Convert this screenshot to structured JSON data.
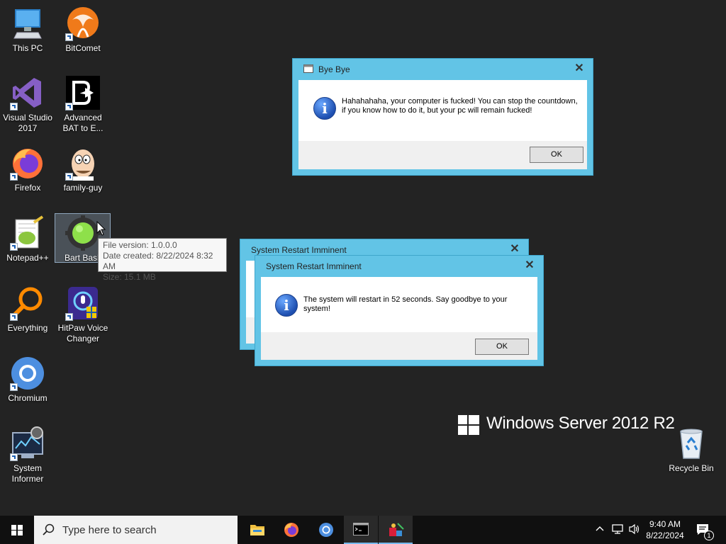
{
  "desktop_icons": [
    {
      "label": "This PC",
      "icon": "this-pc-icon"
    },
    {
      "label": "BitComet",
      "icon": "bitcomet-icon"
    },
    {
      "label": "Visual Studio 2017",
      "icon": "visual-studio-icon"
    },
    {
      "label": "Advanced BAT to E...",
      "icon": "bat-to-exe-icon"
    },
    {
      "label": "Firefox",
      "icon": "firefox-icon"
    },
    {
      "label": "family-guy",
      "icon": "family-guy-icon"
    },
    {
      "label": "Notepad++",
      "icon": "notepad-plus-plus-icon"
    },
    {
      "label": "Bart Bash",
      "icon": "bart-bash-icon"
    },
    {
      "label": "Everything",
      "icon": "everything-icon"
    },
    {
      "label": "HitPaw Voice Changer",
      "icon": "hitpaw-icon"
    },
    {
      "label": "Chromium",
      "icon": "chromium-icon"
    },
    {
      "label": "System Informer",
      "icon": "system-informer-icon"
    },
    {
      "label": "Recycle Bin",
      "icon": "recycle-bin-icon"
    }
  ],
  "tooltip": {
    "file_version": "File version: 1.0.0.0",
    "date_created": "Date created: 8/22/2024 8:32 AM",
    "size": "Size: 15.1 MB"
  },
  "dialogs": {
    "bye_bye": {
      "title": "Bye Bye",
      "message": "Hahahahaha, your computer is fucked! You can stop the countdown, if you know how to do it, but your pc will remain fucked!",
      "ok_label": "OK",
      "close_label": "✕"
    },
    "restart_back": {
      "title": "System Restart Imminent",
      "close_label": "✕"
    },
    "restart_front": {
      "title": "System Restart Imminent",
      "message": "The system will restart in 52 seconds. Say goodbye to your system!",
      "ok_label": "OK",
      "close_label": "✕"
    }
  },
  "branding": {
    "os_name": "Windows Server 2012 R2"
  },
  "taskbar": {
    "search_placeholder": "Type here to search",
    "apps": [
      "file-explorer-icon",
      "firefox-icon",
      "chromium-icon",
      "command-prompt-icon",
      "app-icon"
    ],
    "time": "9:40 AM",
    "date": "8/22/2024",
    "notification_count": "1"
  },
  "colors": {
    "desktop_bg": "#232323",
    "dialog_frame": "#62c4e6",
    "taskbar_bg": "#101010"
  }
}
